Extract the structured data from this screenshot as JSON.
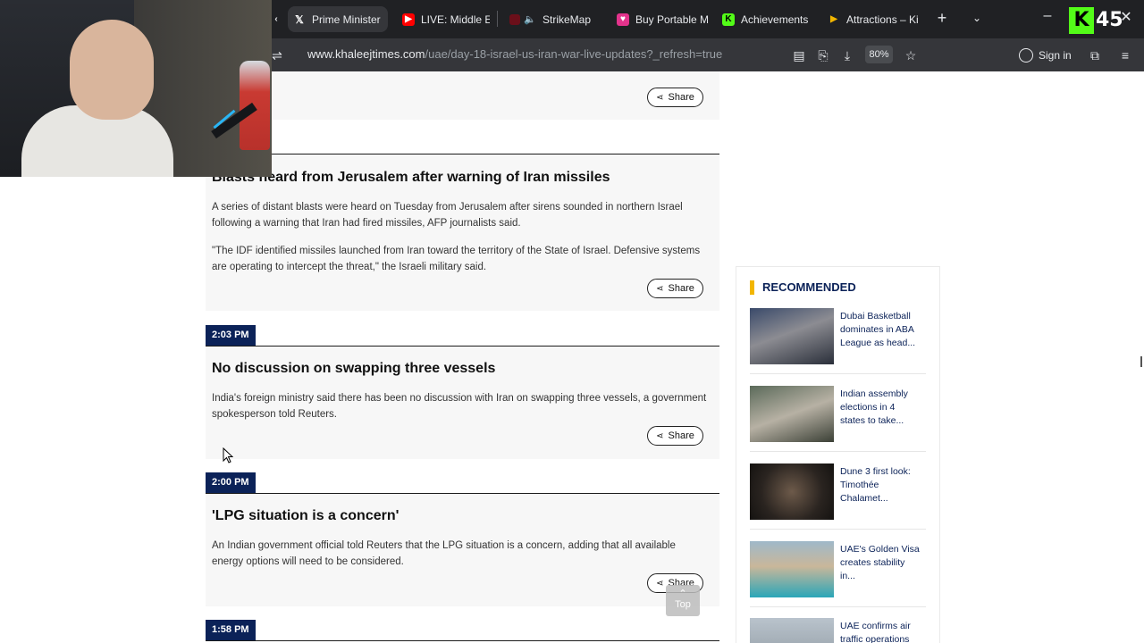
{
  "browser": {
    "tabs": [
      {
        "label": "",
        "icon": "chevron-left-icon"
      },
      {
        "label": "Prime Minister",
        "icon": "x-logo-icon"
      },
      {
        "label": "LIVE: Middle Ea",
        "icon": "youtube-icon"
      },
      {
        "label": "StrikeMap",
        "icon": "mute-icon"
      },
      {
        "label": "Buy Portable M",
        "icon": "gift-icon"
      },
      {
        "label": "Achievements",
        "icon": "kick-icon"
      },
      {
        "label": "Attractions – Ki",
        "icon": "play-icon"
      }
    ],
    "url_host": "www.khaleejtimes.com",
    "url_path": "/uae/day-18-israel-us-iran-war-live-updates?_refresh=true",
    "zoom": "80%",
    "sign_in": "Sign in",
    "overlay_viewer_count": "45",
    "overlay_logo": "K"
  },
  "entries": [
    {
      "headline": "Blasts heard from Jerusalem after warning of Iran missiles",
      "paragraphs": [
        "A series of distant blasts were heard on Tuesday from Jerusalem after sirens sounded in northern Israel following a warning that Iran had fired missiles, AFP journalists said.",
        "\"The IDF identified missiles launched from Iran toward the territory of the State of Israel. Defensive systems are operating to intercept the threat,\" the Israeli military said."
      ],
      "share": "Share"
    },
    {
      "time": "2:03 PM",
      "headline": "No discussion on swapping three vessels",
      "paragraphs": [
        "India's foreign ministry said there has been no discussion with Iran on swapping three vessels, a government spokesperson told Reuters."
      ],
      "share": "Share"
    },
    {
      "time": "2:00 PM",
      "headline": "'LPG situation is a concern'",
      "paragraphs": [
        "An Indian government official told Reuters that the LPG situation is a concern, adding that all available energy options will need to be considered."
      ],
      "share": "Share"
    },
    {
      "time": "1:58 PM"
    }
  ],
  "top_share": "Share",
  "recommended": {
    "title": "RECOMMENDED",
    "items": [
      "Dubai Basketball dominates in ABA League as head...",
      "Indian assembly elections in 4 states to take...",
      "Dune 3 first look: Timothée Chalamet...",
      "UAE's Golden Visa creates stability in...",
      "UAE confirms air traffic operations"
    ]
  },
  "top_button": "Top",
  "colors": {
    "navy": "#0b2258",
    "accent_yellow": "#f2b600",
    "entry_bg": "#f7f7f7"
  }
}
